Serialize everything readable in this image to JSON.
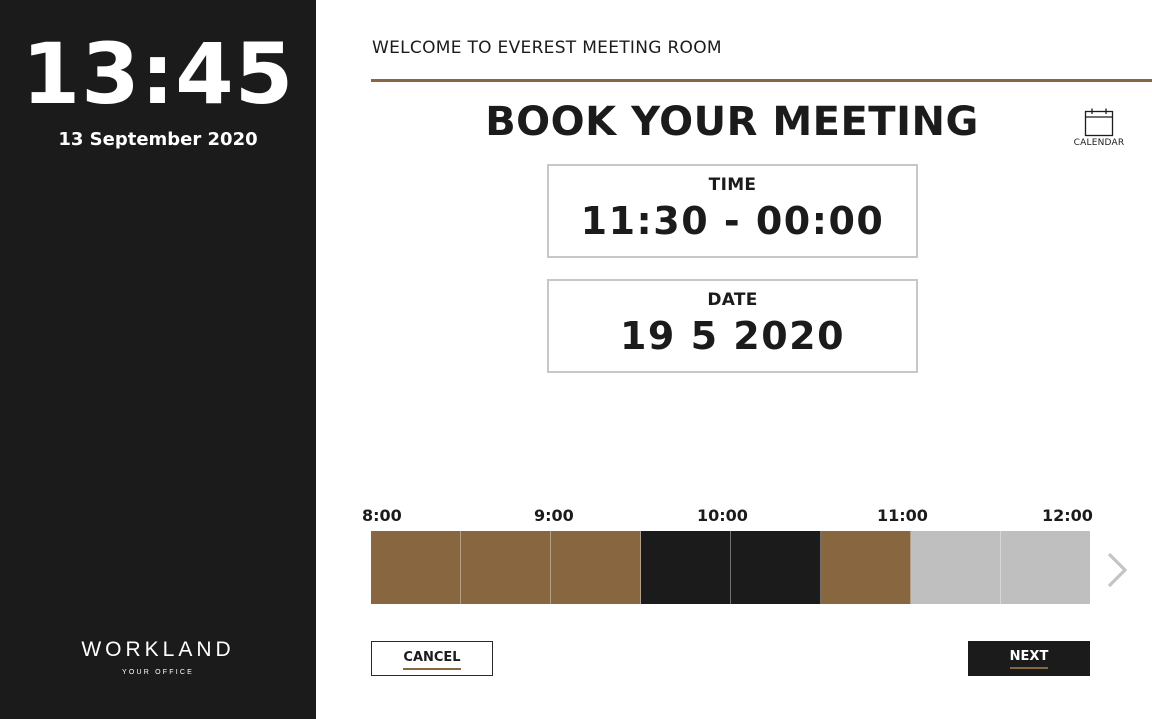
{
  "sidebar": {
    "clock": "13:45",
    "date": "13 September 2020",
    "logo": {
      "wordmark": "WORKLAND",
      "tagline": "YOUR OFFICE"
    }
  },
  "header": {
    "welcome": "WELCOME TO EVEREST MEETING ROOM",
    "accent_color": "#876640"
  },
  "main": {
    "title": "BOOK YOUR MEETING",
    "calendar": {
      "label": "CALENDAR",
      "icon": "calendar-icon"
    },
    "time_box": {
      "label": "TIME",
      "value": "11:30 - 00:00"
    },
    "date_box": {
      "label": "DATE",
      "value": "19 5 2020"
    }
  },
  "timeline": {
    "ticks": [
      "8:00",
      "9:00",
      "10:00",
      "11:00",
      "12:00"
    ],
    "slot_states": [
      "selected",
      "selected",
      "selected",
      "booked",
      "booked",
      "selected",
      "free",
      "free"
    ],
    "state_colors": {
      "selected": "#876640",
      "booked": "#1b1b1b",
      "free": "#bfbfbf"
    },
    "next_icon": "chevron-right-icon"
  },
  "actions": {
    "cancel_label": "CANCEL",
    "next_label": "NEXT"
  }
}
